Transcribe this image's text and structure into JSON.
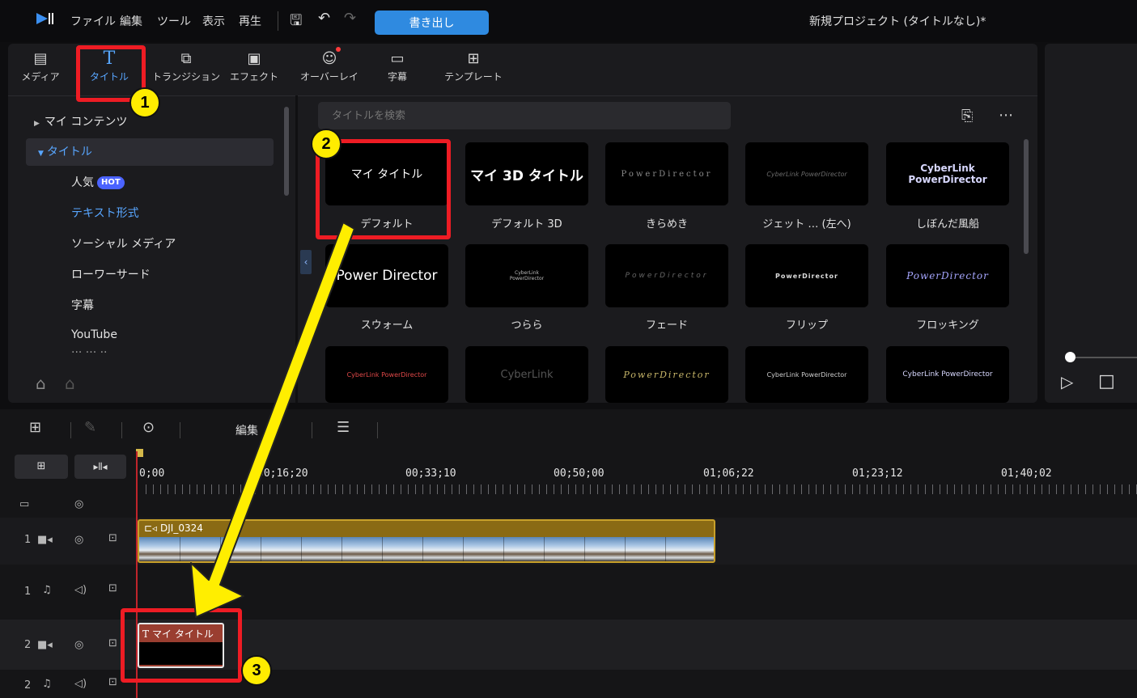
{
  "titlebar": {
    "menu": [
      "ファイル",
      "編集",
      "ツール",
      "表示",
      "再生"
    ],
    "export_label": "書き出し",
    "project_title": "新規プロジェクト (タイトルなし)*"
  },
  "tabs": [
    {
      "label": "メディア",
      "icon": "media-icon"
    },
    {
      "label": "タイトル",
      "icon": "title-icon"
    },
    {
      "label": "トランジション",
      "icon": "transition-icon"
    },
    {
      "label": "エフェクト",
      "icon": "effect-icon"
    },
    {
      "label": "オーバーレイ",
      "icon": "overlay-icon"
    },
    {
      "label": "字幕",
      "icon": "subtitle-icon"
    },
    {
      "label": "テンプレート",
      "icon": "template-icon"
    }
  ],
  "tree": {
    "my_contents": "マイ コンテンツ",
    "titles": "タイトル",
    "items": [
      "人気",
      "テキスト形式",
      "ソーシャル メディア",
      "ローワーサード",
      "字幕",
      "YouTube"
    ],
    "hot_badge": "HOT"
  },
  "search": {
    "placeholder": "タイトルを検索"
  },
  "grid": {
    "row1": [
      {
        "preview": "マイ タイトル",
        "label": "デフォルト"
      },
      {
        "preview": "マイ 3D タイトル",
        "label": "デフォルト 3D"
      },
      {
        "preview": "PowerDirector",
        "label": "きらめき"
      },
      {
        "preview": "CyberLink PowerDirector",
        "label": "ジェット … (左へ)"
      },
      {
        "preview": "CyberLink PowerDirector",
        "label": "しぼんだ風船"
      }
    ],
    "row2": [
      {
        "preview": "Power Director",
        "label": "スウォーム"
      },
      {
        "preview": "CyberLink PowerDirector",
        "label": "つらら"
      },
      {
        "preview": "PowerDirector",
        "label": "フェード"
      },
      {
        "preview": "PowerDirector",
        "label": "フリップ"
      },
      {
        "preview": "PowerDirector",
        "label": "フロッキング"
      }
    ],
    "row3": [
      {
        "preview": "CyberLink PowerDirector"
      },
      {
        "preview": "CyberLink"
      },
      {
        "preview": "PowerDirector"
      },
      {
        "preview": "CyberLink PowerDirector"
      },
      {
        "preview": "CyberLink PowerDirector"
      }
    ]
  },
  "timeline": {
    "edit_label": "編集",
    "ruler": [
      "0;00",
      "00;16;20",
      "00;33;10",
      "00;50;00",
      "01;06;22",
      "01;23;12",
      "01;40;02"
    ],
    "video_clip": "DJI_0324",
    "title_clip": "マイ タイトル",
    "track_numbers": [
      "1",
      "1",
      "2",
      "2"
    ]
  },
  "annotations": [
    "1",
    "2",
    "3"
  ],
  "colors": {
    "accent": "#58a6ff",
    "export": "#2f8ae0",
    "highlight": "#ee1c24",
    "badge": "#ffec00",
    "arrow": "#ffee00"
  }
}
